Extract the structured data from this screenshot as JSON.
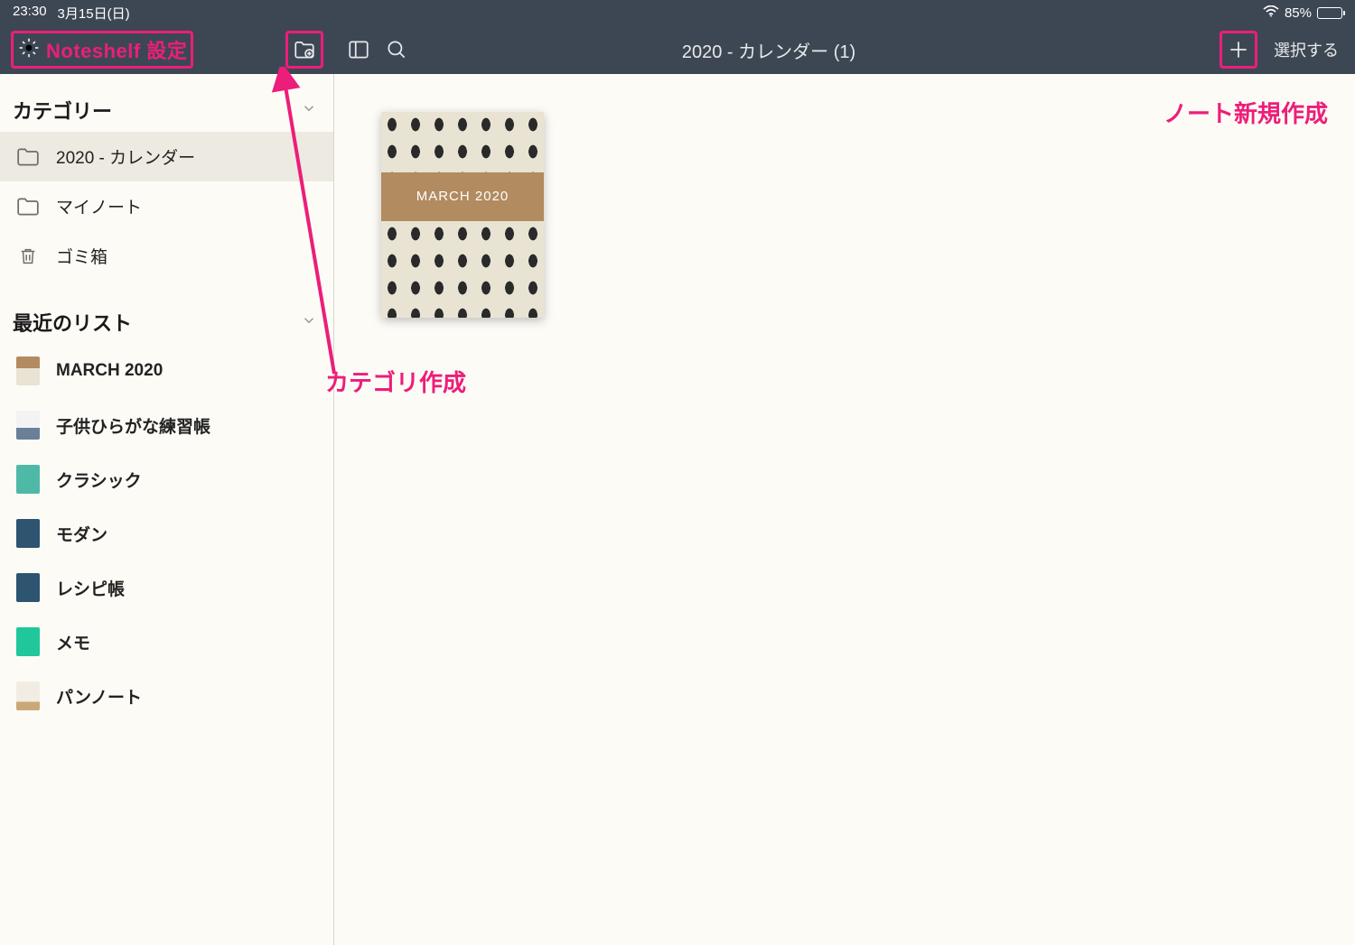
{
  "status": {
    "time": "23:30",
    "date": "3月15日(日)",
    "battery": "85%"
  },
  "toolbar": {
    "settings_label": "Noteshelf 設定",
    "title": "2020 - カレンダー (1)",
    "select_label": "選択する"
  },
  "annotations": {
    "new_note": "ノート新規作成",
    "create_category": "カテゴリ作成"
  },
  "sidebar": {
    "category_header": "カテゴリー",
    "categories": [
      {
        "label": "2020 - カレンダー",
        "icon": "folder",
        "active": true
      },
      {
        "label": "マイノート",
        "icon": "folder",
        "active": false
      },
      {
        "label": "ゴミ箱",
        "icon": "trash",
        "active": false
      }
    ],
    "recent_header": "最近のリスト",
    "recent": [
      {
        "label": "MARCH 2020",
        "thumb": "thumb-march"
      },
      {
        "label": "子供ひらがな練習帳",
        "thumb": "thumb-kids"
      },
      {
        "label": "クラシック",
        "thumb": "thumb-classic"
      },
      {
        "label": "モダン",
        "thumb": "thumb-modern"
      },
      {
        "label": "レシピ帳",
        "thumb": "thumb-recipe"
      },
      {
        "label": "メモ",
        "thumb": "thumb-memo"
      },
      {
        "label": "パンノート",
        "thumb": "thumb-pan"
      }
    ]
  },
  "note": {
    "band_label": "MARCH 2020"
  }
}
